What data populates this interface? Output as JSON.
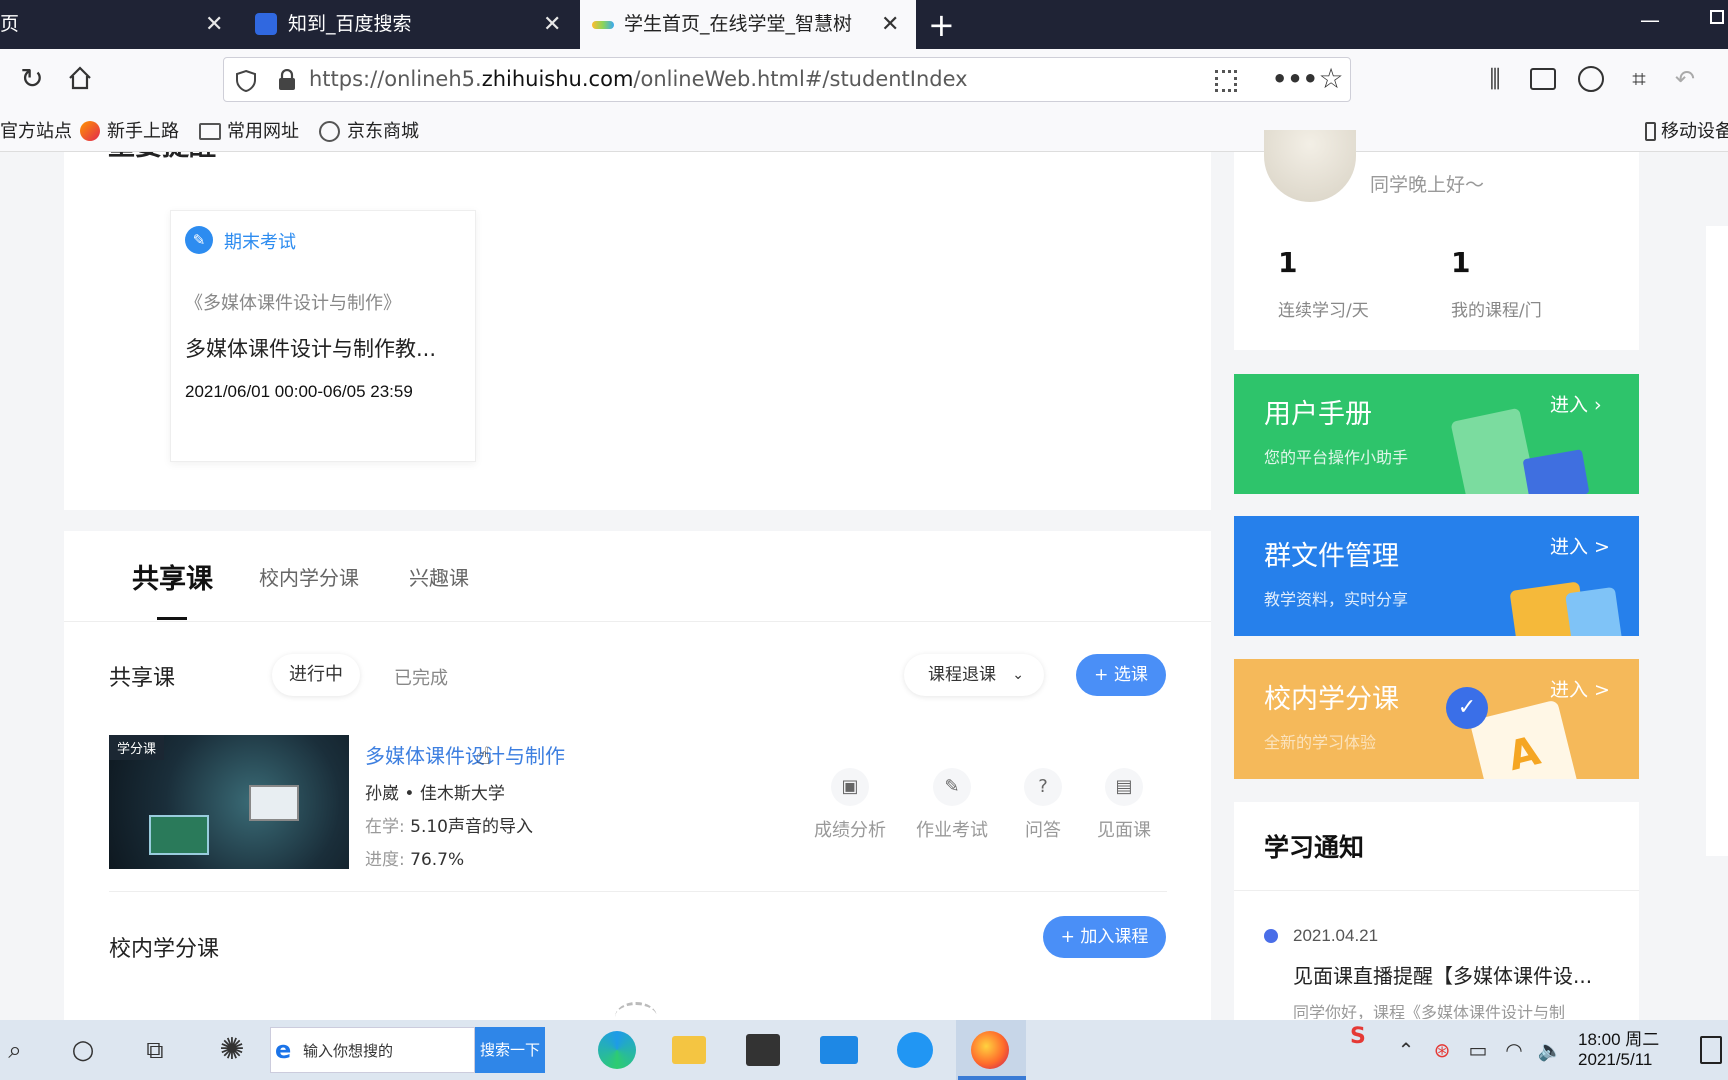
{
  "browser": {
    "tabs": [
      {
        "label": "页"
      },
      {
        "label": "知到_百度搜索"
      },
      {
        "label": "学生首页_在线学堂_智慧树"
      }
    ],
    "new_tab": "+",
    "url_prefix": "https://onlineh5.",
    "url_domain": "zhihuishu.com",
    "url_path": "/onlineWeb.html#/studentIndex",
    "bookmarks": [
      "官方站点",
      "新手上路",
      "常用网址",
      "京东商城"
    ],
    "mobile_bookmarks": "移动设备"
  },
  "reminder": {
    "section_title": "重要提醒",
    "card": {
      "tag": "期末考试",
      "course": "《多媒体课件设计与制作》",
      "title": "多媒体课件设计与制作教...",
      "time": "2021/06/01 00:00-06/05 23:59"
    }
  },
  "courses": {
    "tabs": [
      "共享课",
      "校内学分课",
      "兴趣课"
    ],
    "shared": {
      "heading": "共享课",
      "filters": [
        "进行中",
        "已完成"
      ],
      "withdraw": "课程退课",
      "select_button": "+ 选课",
      "item": {
        "badge": "学分课",
        "title": "多媒体课件设计与制作",
        "teacher": "孙崴 • 佳木斯大学",
        "current_label": "在学: ",
        "current_value": "5.10声音的导入",
        "progress_label": "进度: ",
        "progress_value": "76.7%",
        "actions": [
          "成绩分析",
          "作业考试",
          "问答",
          "见面课"
        ]
      }
    },
    "campus": {
      "heading": "校内学分课",
      "join_button": "+ 加入课程"
    }
  },
  "profile": {
    "greeting": "同学晚上好～",
    "stats": [
      {
        "value": "1",
        "label": "连续学习/天"
      },
      {
        "value": "1",
        "label": "我的课程/门"
      }
    ]
  },
  "side_cards": [
    {
      "title": "用户手册",
      "subtitle": "您的平台操作小助手",
      "enter": "进入 ›",
      "color": "#2ec46b"
    },
    {
      "title": "群文件管理",
      "subtitle": "教学资料，实时分享",
      "enter": "进入 >",
      "color": "#2680eb"
    },
    {
      "title": "校内学分课",
      "subtitle": "全新的学习体验",
      "enter": "进入 >",
      "color": "#f5b95a"
    }
  ],
  "notice": {
    "heading": "学习通知",
    "date": "2021.04.21",
    "title": "见面课直播提醒【多媒体课件设...",
    "body": "同学你好，课程《多媒体课件设计与制"
  },
  "taskbar": {
    "search_placeholder": "输入你想搜的",
    "search_button": "搜索一下",
    "time": "18:00 周二",
    "date": "2021/5/11"
  }
}
